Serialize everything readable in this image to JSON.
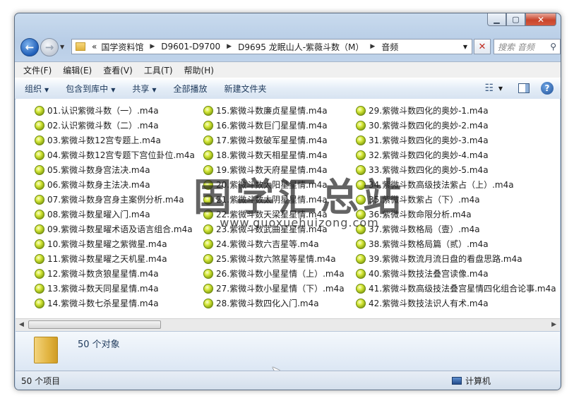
{
  "window": {
    "caption": {
      "minimize": "▁",
      "maximize": "▢",
      "close": "✕"
    }
  },
  "address": {
    "overflow": "«",
    "crumbs": [
      "国学资料馆",
      "D9601-D9700",
      "D9695 龙眠山人-紫薇斗数（M）",
      "音频"
    ],
    "search_placeholder": "搜索 音频"
  },
  "menu": [
    "文件(F)",
    "编辑(E)",
    "查看(V)",
    "工具(T)",
    "帮助(H)"
  ],
  "commands": [
    {
      "label": "组织",
      "dropdown": true
    },
    {
      "label": "包含到库中",
      "dropdown": true
    },
    {
      "label": "共享",
      "dropdown": true
    },
    {
      "label": "全部播放",
      "dropdown": false
    },
    {
      "label": "新建文件夹",
      "dropdown": false
    }
  ],
  "icons": {
    "back": "back-arrow-icon",
    "forward": "forward-arrow-icon",
    "search": "search-icon",
    "refresh": "refresh-icon",
    "file": "m4a-audio-file-icon",
    "help": "help-icon"
  },
  "files": [
    [
      "01.认识紫微斗数（一）.m4a",
      "02.认识紫微斗数（二）.m4a",
      "03.紫微斗数12宫专题上.m4a",
      "04.紫微斗数12宫专题下宫位卦位.m4a",
      "05.紫微斗数身宫法决.m4a",
      "06.紫微斗数身主法决.m4a",
      "07.紫微斗数身宫身主案例分析.m4a",
      "08.紫微斗数星曜入门.m4a",
      "09.紫微斗数星曜术语及语言组合.m4a",
      "10.紫微斗数星曜之紫微星.m4a",
      "11.紫微斗数星曜之天机星.m4a",
      "12.紫微斗数贪狼星星情.m4a",
      "13.紫微斗数天同星星情.m4a",
      "14.紫微斗数七杀星星情.m4a"
    ],
    [
      "15.紫微斗数廉贞星星情.m4a",
      "16.紫微斗数巨门星星情.m4a",
      "17.紫微斗数破军星星情.m4a",
      "18.紫微斗数天相星星情.m4a",
      "19.紫微斗数天府星星情.m4a",
      "20.紫微斗数太阳星星情.m4a",
      "21.紫微斗数太阴星星情.m4a",
      "22.紫微斗数天梁星星情.m4a",
      "23.紫微斗数武曲星星情.m4a",
      "24.紫微斗数六吉星等.m4a",
      "25.紫微斗数六煞星等星情.m4a",
      "26.紫微斗数小星星情（上）.m4a",
      "27.紫微斗数小星星情（下）.m4a",
      "28.紫微斗数四化入门.m4a"
    ],
    [
      "29.紫微斗数四化的奥妙-1.m4a",
      "30.紫微斗数四化的奥妙-2.m4a",
      "31.紫微斗数四化的奥妙-3.m4a",
      "32.紫微斗数四化的奥妙-4.m4a",
      "33.紫微斗数四化的奥妙-5.m4a",
      "34.紫微斗数高级技法紫占（上）.m4a",
      "35.紫微斗数紫占（下）.m4a",
      "36.紫微斗数命限分析.m4a",
      "37.紫微斗数格局（壹）.m4a",
      "38.紫微斗数格局篇（贰）.m4a",
      "39.紫微斗数流月流日盘的看盘思路.m4a",
      "40.紫微斗数技法叠宫读像.m4a",
      "41.紫微斗数高级技法叠宫星情四化组合论事.m4a",
      "42.紫微斗数技法识人有术.m4a"
    ]
  ],
  "watermark": {
    "title": "国学汇总站",
    "url": "www.guoxuehuizong.com"
  },
  "details": {
    "count": "50 个对象"
  },
  "status": {
    "items": "50 个项目",
    "zone": "计算机"
  }
}
